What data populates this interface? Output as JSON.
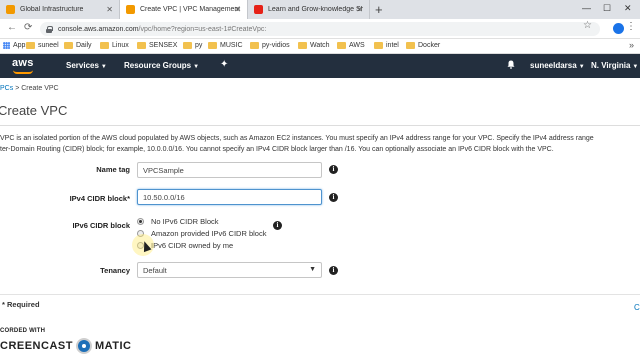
{
  "browser": {
    "tabs": [
      {
        "title": "Global Infrastructure",
        "favicon_color": "#f29900"
      },
      {
        "title": "Create VPC | VPC Management C",
        "favicon_color": "#f29900"
      },
      {
        "title": "Learn and Grow-knowledge Sha",
        "favicon_color": "#e62117"
      }
    ],
    "new_tab": "+",
    "window_controls": [
      "—",
      "☐",
      "✕"
    ],
    "url_host": "console.aws.amazon.com",
    "url_path": "/vpc/home?region=us-east-1#CreateVpc:",
    "bookmarks": [
      "Apps",
      "suneel",
      "Daily",
      "Linux",
      "SENSEX",
      "py",
      "MUSIC",
      "py-vidios",
      "Watch",
      "AWS",
      "intel",
      "Docker"
    ],
    "bookmarks_more": "»"
  },
  "aws_nav": {
    "logo": "aws",
    "services": "Services",
    "resource_groups": "Resource Groups",
    "user": "suneeldarsa",
    "region": "N. Virginia"
  },
  "breadcrumb": {
    "link": "PCs",
    "separator": ">",
    "current": "Create VPC"
  },
  "page": {
    "title": "Create VPC",
    "description_line1": "VPC is an isolated portion of the AWS cloud populated by AWS objects, such as Amazon EC2 instances. You must specify an IPv4 address range for your VPC. Specify the IPv4 address range",
    "description_line2": "ter-Domain Routing (CIDR) block; for example, 10.0.0.0/16. You cannot specify an IPv4 CIDR block larger than /16. You can optionally associate an IPv6 CIDR block with the VPC."
  },
  "form": {
    "name_tag": {
      "label": "Name tag",
      "value": "VPCSample"
    },
    "ipv4_cidr": {
      "label": "IPv4 CIDR block*",
      "value": "10.50.0.0/16"
    },
    "ipv6_cidr": {
      "label": "IPv6 CIDR block",
      "options": [
        "No IPv6 CIDR Block",
        "Amazon provided IPv6 CIDR block",
        "IPv6 CIDR owned by me"
      ],
      "selected": "No IPv6 CIDR Block"
    },
    "tenancy": {
      "label": "Tenancy",
      "value": "Default"
    },
    "info_symbol": "i"
  },
  "footer": {
    "required": "Required",
    "c_link": "C"
  },
  "watermark": {
    "line1": "CORDED WITH",
    "left": "CREENCAST",
    "right": "MATIC"
  }
}
